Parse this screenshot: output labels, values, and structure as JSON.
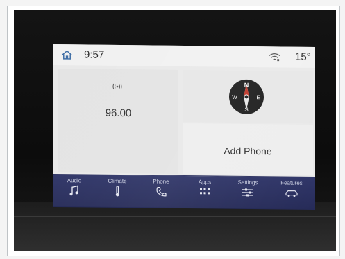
{
  "status_bar": {
    "time": "9:57",
    "temperature": "15°",
    "home_icon": "home-icon",
    "connectivity_icon": "wifi-icon"
  },
  "radio": {
    "frequency": "96.00",
    "signal_icon": "radio-signal-icon"
  },
  "compass": {
    "icon": "compass-icon",
    "directions": [
      "N",
      "E",
      "S",
      "W"
    ]
  },
  "phone_panel": {
    "label": "Add Phone"
  },
  "nav": {
    "items": [
      {
        "label": "Audio",
        "icon": "music-note-icon"
      },
      {
        "label": "Climate",
        "icon": "thermometer-icon"
      },
      {
        "label": "Phone",
        "icon": "phone-handset-icon"
      },
      {
        "label": "Apps",
        "icon": "apps-grid-icon"
      },
      {
        "label": "Settings",
        "icon": "sliders-icon"
      },
      {
        "label": "Features",
        "icon": "vehicle-icon"
      }
    ]
  },
  "colors": {
    "nav_background": "#2c3263",
    "screen_background": "#e9e9e9",
    "icon_accent": "#3f6ea6"
  }
}
